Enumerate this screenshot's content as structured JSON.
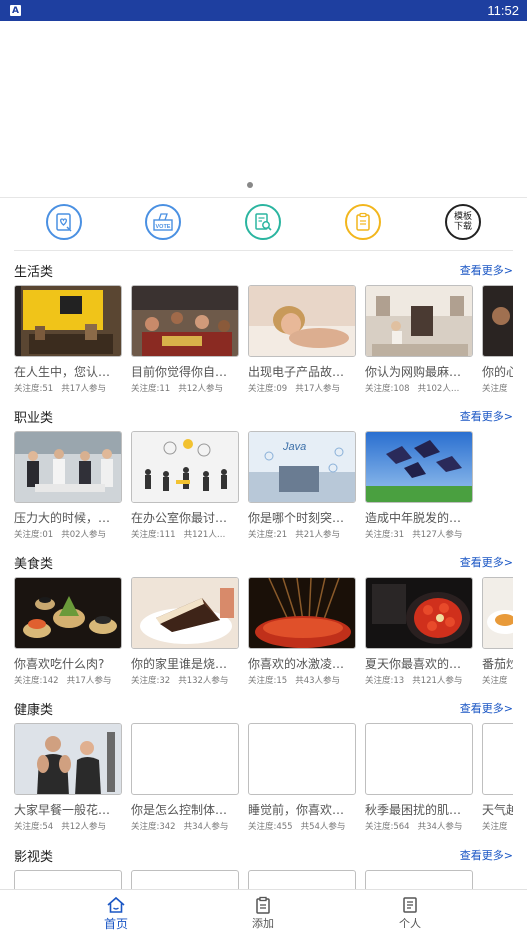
{
  "status_bar": {
    "time": "11:52",
    "notification_icon": "A"
  },
  "quick_actions": [
    {
      "name": "heart-certificate-icon",
      "color": "#4a90e2"
    },
    {
      "name": "vote-box-icon",
      "color": "#4a90e2",
      "text": "VOTE"
    },
    {
      "name": "document-search-icon",
      "color": "#2bb5a0"
    },
    {
      "name": "clipboard-icon",
      "color": "#f2b61d"
    },
    {
      "name": "template-download-icon",
      "color": "#222222",
      "text_line1": "模板",
      "text_line2": "下载"
    }
  ],
  "more_label": "查看更多>",
  "sections": [
    {
      "title": "生活类",
      "cards": [
        {
          "title": "在人生中，您认…",
          "followers": "关注度:51",
          "participants": "共17人参与",
          "image": "cafe"
        },
        {
          "title": "目前你觉得你自…",
          "followers": "关注度:11",
          "participants": "共12人参与",
          "image": "crowd"
        },
        {
          "title": "出现电子产品故…",
          "followers": "关注度:09",
          "participants": "共17人参与",
          "image": "portrait"
        },
        {
          "title": "你认为网购最麻…",
          "followers": "关注度:108",
          "participants": "共102人…",
          "image": "room"
        },
        {
          "title": "你的心…",
          "followers": "关注度",
          "participants": "",
          "image": "dark"
        }
      ]
    },
    {
      "title": "职业类",
      "cards": [
        {
          "title": "压力大的时候，…",
          "followers": "关注度:01",
          "participants": "共02人参与",
          "image": "office"
        },
        {
          "title": "在办公室你最讨…",
          "followers": "关注度:111",
          "participants": "共121人…",
          "image": "silhouettes"
        },
        {
          "title": "你是哪个时刻突…",
          "followers": "关注度:21",
          "participants": "共21人参与",
          "image": "tech"
        },
        {
          "title": "造成中年脱发的…",
          "followers": "关注度:31",
          "participants": "共127人参与",
          "image": "graduation"
        }
      ]
    },
    {
      "title": "美食类",
      "cards": [
        {
          "title": "你喜欢吃什么肉?",
          "followers": "关注度:142",
          "participants": "共17人参与",
          "image": "appetizer"
        },
        {
          "title": "你的家里谁是烧…",
          "followers": "关注度:32",
          "participants": "共132人参与",
          "image": "cake"
        },
        {
          "title": "你喜欢的冰激凌…",
          "followers": "关注度:15",
          "participants": "共43人参与",
          "image": "skewers"
        },
        {
          "title": "夏天你最喜欢的…",
          "followers": "关注度:13",
          "participants": "共121人参与",
          "image": "crayfish"
        },
        {
          "title": "番茄炒…",
          "followers": "关注度",
          "participants": "",
          "image": "plate"
        }
      ]
    },
    {
      "title": "健康类",
      "cards": [
        {
          "title": "大家早餐一般花…",
          "followers": "关注度:54",
          "participants": "共12人参与",
          "image": "fitness"
        },
        {
          "title": "你是怎么控制体…",
          "followers": "关注度:342",
          "participants": "共34人参与",
          "image": "blank"
        },
        {
          "title": "睡觉前，你喜欢…",
          "followers": "关注度:455",
          "participants": "共54人参与",
          "image": "blank"
        },
        {
          "title": "秋季最困扰的肌…",
          "followers": "关注度:564",
          "participants": "共34人参与",
          "image": "blank"
        },
        {
          "title": "天气越…",
          "followers": "关注度",
          "participants": "",
          "image": "blank"
        }
      ]
    },
    {
      "title": "影视类",
      "cards": [
        {
          "title": "",
          "followers": "",
          "participants": "",
          "image": "blank"
        },
        {
          "title": "",
          "followers": "",
          "participants": "",
          "image": "blank"
        },
        {
          "title": "",
          "followers": "",
          "participants": "",
          "image": "blank"
        },
        {
          "title": "",
          "followers": "",
          "participants": "",
          "image": "blank"
        }
      ]
    }
  ],
  "tab_bar": [
    {
      "label": "首页",
      "icon": "home-icon",
      "active": true
    },
    {
      "label": "添加",
      "icon": "add-document-icon",
      "active": false
    },
    {
      "label": "个人",
      "icon": "profile-document-icon",
      "active": false
    }
  ],
  "colors": {
    "status_bar": "#1e3fa0",
    "accent": "#1a56c4"
  }
}
